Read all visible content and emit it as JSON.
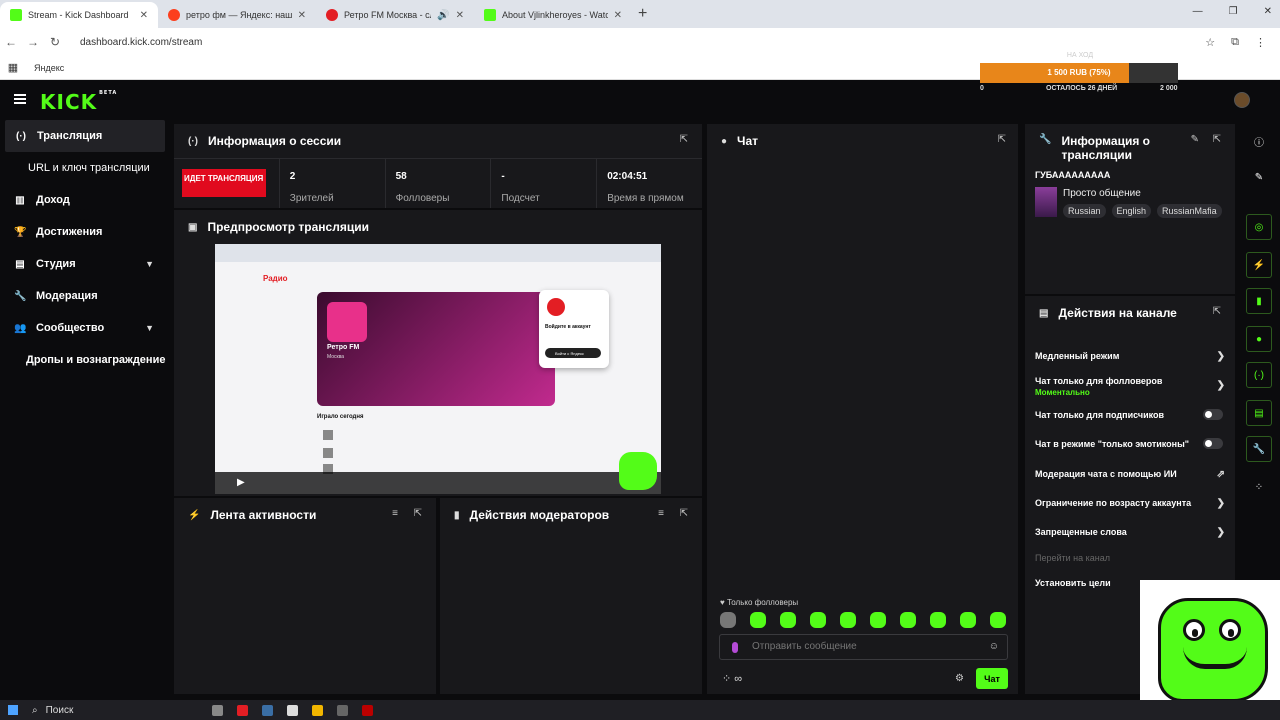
{
  "browser": {
    "tabs": [
      {
        "label": "Stream - Kick Dashboard",
        "color": "#53fc18"
      },
      {
        "label": "ретро фм — Яндекс: нашлось",
        "color": "#fc3f1d"
      },
      {
        "label": "Ретро FM Москва - слуша",
        "color": "#e31e24"
      },
      {
        "label": "About Vjlinkheroyes - Watch Li",
        "color": "#53fc18"
      }
    ],
    "url": "dashboard.kick.com/stream",
    "bookmark": "Яндекс"
  },
  "goal": {
    "title": "НА ХОД",
    "progress_label": "1 500 RUB (75%)",
    "progress_pct": 75,
    "start": "0",
    "left": "ОСТАЛОСЬ 26 ДНЕЙ",
    "max": "2 000"
  },
  "logo": "KICK",
  "logo_badge": "BETA",
  "sidebar": {
    "items": [
      {
        "label": "Трансляция",
        "icon": "broadcast-icon"
      },
      {
        "label": "URL и ключ трансляции",
        "icon": ""
      },
      {
        "label": "Доход",
        "icon": "chart-icon"
      },
      {
        "label": "Достижения",
        "icon": "trophy-icon"
      },
      {
        "label": "Студия",
        "icon": "studio-icon"
      },
      {
        "label": "Модерация",
        "icon": "wrench-icon"
      },
      {
        "label": "Сообщество",
        "icon": "people-icon"
      },
      {
        "label": "Дропы и вознаграждение",
        "icon": ""
      }
    ]
  },
  "session": {
    "title": "Информация о сессии",
    "live_label": "ИДЕТ ТРАНСЛЯЦИЯ",
    "stats": [
      {
        "value": "2",
        "label": "Зрителей"
      },
      {
        "value": "58",
        "label": "Фолловеры"
      },
      {
        "value": "-",
        "label": "Подсчет"
      },
      {
        "value": "02:04:51",
        "label": "Время в прямом"
      }
    ]
  },
  "preview": {
    "title": "Предпросмотр трансляции",
    "radio_logo": "Радио",
    "station": "Ретро FM",
    "city": "Москва",
    "login_title": "Войдите в аккаунт",
    "login_button": "Войти с Яндекс",
    "played_today": "Играло сегодня"
  },
  "chat": {
    "title": "Чат",
    "only_followers": "Только фолловеры",
    "placeholder": "Отправить сообщение",
    "send_label": "Чат"
  },
  "activity": {
    "title": "Лента активности"
  },
  "modactions": {
    "title": "Действия модераторов"
  },
  "streaminfo": {
    "title": "Информация о трансляции",
    "stream_name": "ГУБААААААААА",
    "category": "Просто общение",
    "tags": [
      "Russian",
      "English",
      "RussianMafia"
    ]
  },
  "channel_actions": {
    "title": "Действия на канале",
    "rows": [
      {
        "label": "Медленный режим",
        "kind": "chevron"
      },
      {
        "label": "Чат только для фолловеров",
        "sub": "Моментально",
        "kind": "chevron"
      },
      {
        "label": "Чат только для подписчиков",
        "kind": "toggle"
      },
      {
        "label": "Чат в режиме \"только эмотиконы\"",
        "kind": "toggle"
      },
      {
        "label": "Модерация чата с помощью ИИ",
        "kind": "external"
      },
      {
        "label": "Ограничение по возрасту аккаунта",
        "kind": "chevron"
      },
      {
        "label": "Запрещенные слова",
        "kind": "chevron"
      },
      {
        "label": "Перейти на канал",
        "kind": "disabled"
      },
      {
        "label": "Установить цели",
        "kind": "chevron"
      }
    ]
  },
  "taskbar": {
    "search": "Поиск"
  }
}
